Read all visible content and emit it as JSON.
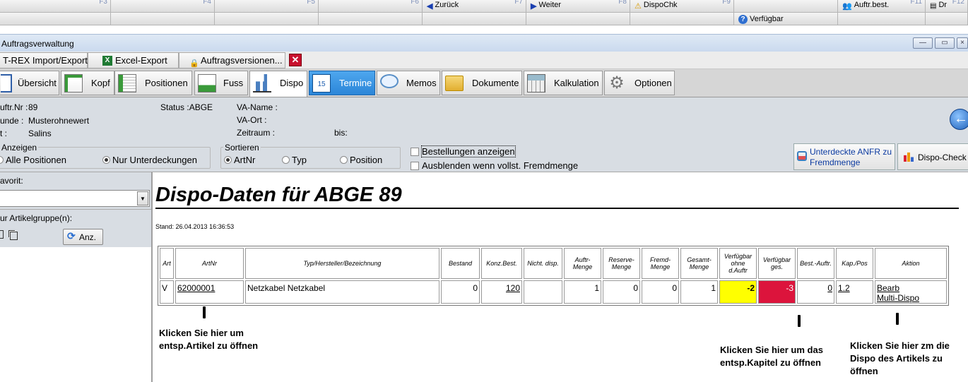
{
  "fkeys": [
    {
      "label": "",
      "num": "F3"
    },
    {
      "label": "",
      "num": "F4"
    },
    {
      "label": "",
      "num": "F5"
    },
    {
      "label": "",
      "num": "F6"
    },
    {
      "label": "Zurück",
      "num": "F7",
      "icon": "arrow-left-icon"
    },
    {
      "label": "Weiter",
      "num": "F8",
      "icon": "arrow-right-icon"
    },
    {
      "label": "DispoChk",
      "num": "F9",
      "icon": "warning-icon"
    },
    {
      "label": "Auftr.best.",
      "num": "F11",
      "icon": "people-icon"
    },
    {
      "label": "Dr",
      "num": "F12",
      "icon": "print-icon"
    }
  ],
  "verfuegbar_label": "Verfügbar",
  "window_title": "Auftragsverwaltung",
  "toolbar": {
    "import_export": "T-REX Import/Export",
    "excel_export": "Excel-Export",
    "auftragsversionen": "Auftragsversionen..."
  },
  "tabs": [
    {
      "label": "Übersicht",
      "icon": "overview-icon"
    },
    {
      "label": "Kopf",
      "icon": "header-doc-icon"
    },
    {
      "label": "Positionen",
      "icon": "positions-icon"
    },
    {
      "label": "Fuss",
      "icon": "footer-doc-icon"
    },
    {
      "label": "Dispo",
      "icon": "bar-chart-icon"
    },
    {
      "label": "Termine",
      "icon": "calendar-icon"
    },
    {
      "label": "Memos",
      "icon": "speech-bubble-icon"
    },
    {
      "label": "Dokumente",
      "icon": "folder-icon"
    },
    {
      "label": "Kalkulation",
      "icon": "calculator-icon"
    },
    {
      "label": "Optionen",
      "icon": "gear-icon"
    }
  ],
  "info": {
    "auftr_nr_label": "uftr.Nr :",
    "auftr_nr": "89",
    "kunde_label": "unde :",
    "kunde": "Musterohnewert",
    "ort_label": "t :",
    "ort": "Salins",
    "status": "Status :ABGE",
    "va_name": "VA-Name :",
    "va_ort": "VA-Ort :",
    "zeitraum": "Zeitraum :",
    "bis": "bis:"
  },
  "filters": {
    "anzeigen_label": "Anzeigen",
    "alle_positionen": "Alle Positionen",
    "nur_unterdeckungen": "Nur Unterdeckungen",
    "sortieren_label": "Sortieren",
    "artnr": "ArtNr",
    "typ": "Typ",
    "position": "Position",
    "bestellungen": "Bestellungen anzeigen",
    "ausblenden": "Ausblenden wenn vollst. Fremdmenge",
    "unterdeckte": "Unterdeckte ANFR zu Fremdmenge",
    "dispo_check": "Dispo-Check"
  },
  "left": {
    "favorit_label": "avorit:",
    "artikelgruppe_label": "ur Artikelgruppe(n):",
    "anz_button": "Anz."
  },
  "report": {
    "heading": "Dispo-Daten für ABGE 89",
    "stand": "Stand: 26.04.2013 16:36:53",
    "headers": [
      "Art",
      "ArtNr",
      "Typ/Hersteller/Bezeichnung",
      "Bestand",
      "Konz.Best.",
      "Nicht. disp.",
      "Auftr-Menge",
      "Reserve-Menge",
      "Fremd-Menge",
      "Gesamt-Menge",
      "Verfügbar ohne d.Auftr",
      "Verfügbar ges.",
      "Best.-Auftr.",
      "Kap./Pos",
      "Aktion"
    ],
    "row": {
      "art": "V",
      "artnr": "62000001",
      "bezeichnung": "Netzkabel Netzkabel",
      "bestand": "0",
      "konz_best": "120",
      "nicht_disp": "",
      "auftr_menge": "1",
      "reserve_menge": "0",
      "fremd_menge": "0",
      "gesamt_menge": "1",
      "verf_ohne": "-2",
      "verf_ges": "-3",
      "best_auftr": "0",
      "kap_pos": "1.2",
      "aktion_bearb": "Bearb",
      "aktion_multi": "Multi-Dispo"
    },
    "colors": {
      "yellow": "#ffff00",
      "red": "#dc143c"
    }
  },
  "notes": {
    "artikel_1": "Klicken Sie hier um",
    "artikel_2": "entsp.Artikel zu öffnen",
    "kapitel_1": "Klicken Sie hier um das",
    "kapitel_2": "entsp.Kapitel zu öffnen",
    "dispo_1": "Klicken Sie hier zm die",
    "dispo_2": "Dispo des Artikels zu",
    "dispo_3": "öffnen"
  }
}
